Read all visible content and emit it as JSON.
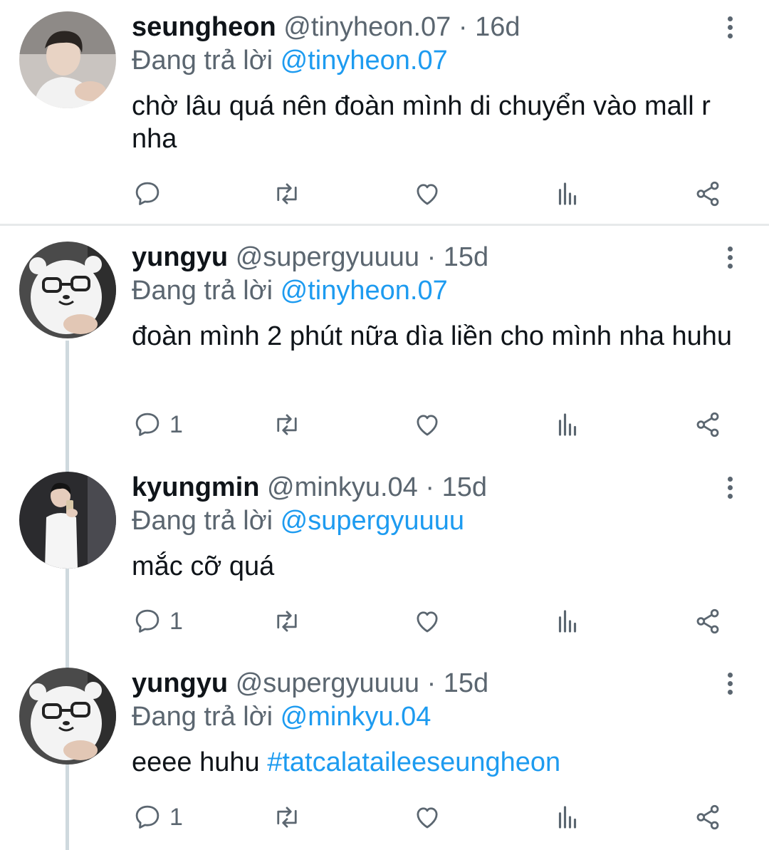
{
  "tweets": [
    {
      "name": "seungheon",
      "handle": "@tinyheon.07",
      "sep": "·",
      "time": "16d",
      "reply_prefix": "Đang trả lời",
      "reply_to": "@tinyheon.07",
      "text": "chờ lâu quá nên đoàn mình di chuyển vào mall r nha",
      "hashtag": "",
      "reply_count": ""
    },
    {
      "name": "yungyu",
      "handle": "@supergyuuuu",
      "sep": "·",
      "time": "15d",
      "reply_prefix": "Đang trả lời",
      "reply_to": "@tinyheon.07",
      "text": "đoàn mình 2 phút nữa dìa liền cho mình nha huhu",
      "hashtag": "",
      "reply_count": "1"
    },
    {
      "name": "kyungmin",
      "handle": "@minkyu.04",
      "sep": "·",
      "time": "15d",
      "reply_prefix": "Đang trả lời",
      "reply_to": "@supergyuuuu",
      "text": "mắc cỡ quá",
      "hashtag": "",
      "reply_count": "1"
    },
    {
      "name": "yungyu",
      "handle": "@supergyuuuu",
      "sep": "·",
      "time": "15d",
      "reply_prefix": "Đang trả lời",
      "reply_to": "@minkyu.04",
      "text": "eeee huhu ",
      "hashtag": "#tatcalataileeseungheon",
      "reply_count": "1"
    }
  ],
  "icons": [
    "reply-icon",
    "retweet-icon",
    "like-icon",
    "views-icon",
    "share-icon",
    "more-icon"
  ],
  "colors": {
    "link": "#1d9bf0",
    "muted": "#5b6670",
    "text": "#0f1419"
  }
}
